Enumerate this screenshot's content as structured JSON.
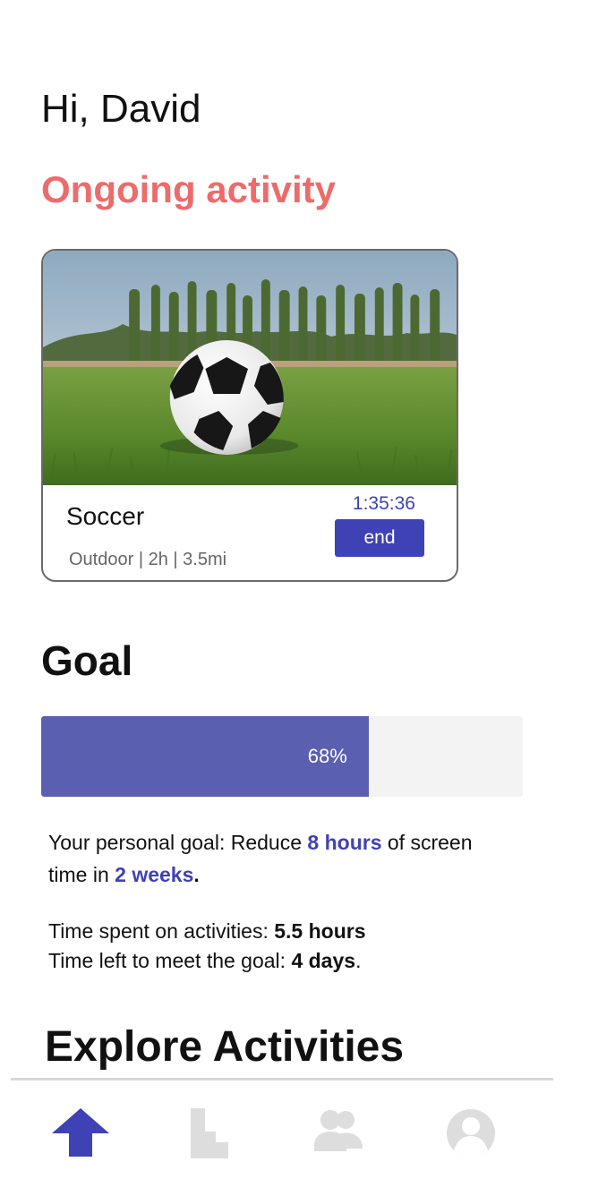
{
  "greeting": "Hi, David",
  "ongoing": {
    "title": "Ongoing activity",
    "activity": {
      "name": "Soccer",
      "category": "Outdoor",
      "duration": "2h",
      "distance": "3.5mi",
      "timer": "1:35:36",
      "end_label": "end"
    }
  },
  "goal": {
    "title": "Goal",
    "progress_percent": 68,
    "progress_label": "68%",
    "personal_prefix": "Your personal goal: Reduce ",
    "hours": "8 hours",
    "personal_middle": " of screen time in ",
    "weeks": "2 weeks",
    "personal_end": ".",
    "spent_label": "Time spent on activities: ",
    "spent_value": "5.5 hours",
    "left_label": "Time left to meet the goal: ",
    "left_value": "4 days",
    "left_end": "."
  },
  "explore": {
    "title": "Explore Activities"
  },
  "nav": {
    "items": [
      {
        "icon": "home-icon",
        "active": true
      },
      {
        "icon": "stats-icon",
        "active": false
      },
      {
        "icon": "community-icon",
        "active": false
      },
      {
        "icon": "profile-icon",
        "active": false
      }
    ]
  },
  "colors": {
    "accent_red": "#ee6b6b",
    "accent_blue": "#3f42b4",
    "progress_fill": "#5b5fb0",
    "nav_inactive": "#dddddd"
  }
}
